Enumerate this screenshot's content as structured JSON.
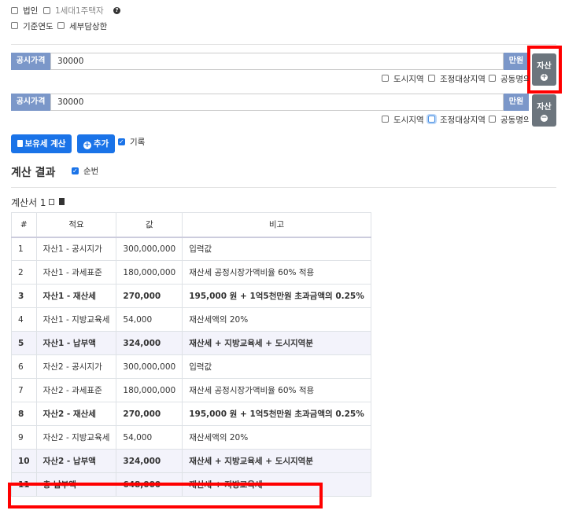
{
  "top_options": {
    "corporation": {
      "label": "법인",
      "checked": false
    },
    "one_house": {
      "label": "1세대1주택자",
      "checked": false
    },
    "base_year": {
      "label": "기준연도",
      "checked": false
    },
    "tax_cap": {
      "label": "세부담상한",
      "checked": false
    }
  },
  "assets": [
    {
      "price_label": "공시가격",
      "price_value": "30000",
      "unit": "만원",
      "button_label": "자산",
      "checks": [
        {
          "label": "도시지역",
          "checked": false
        },
        {
          "label": "조정대상지역",
          "checked": false
        },
        {
          "label": "공동명의",
          "checked": false
        }
      ]
    },
    {
      "price_label": "공시가격",
      "price_value": "30000",
      "unit": "만원",
      "button_label": "자산",
      "checks": [
        {
          "label": "도시지역",
          "checked": false
        },
        {
          "label": "조정대상지역",
          "checked": false
        },
        {
          "label": "공동명의",
          "checked": false
        }
      ]
    }
  ],
  "actions": {
    "calc_label": "보유세 계산",
    "add_label": "추가",
    "record_label": "기록",
    "record_checked": true
  },
  "result": {
    "title": "계산 결과",
    "order_label": "순번",
    "order_checked": true,
    "statement_title": "계산서 1"
  },
  "table": {
    "headers": [
      "#",
      "적요",
      "값",
      "비고"
    ],
    "rows": [
      {
        "no": "1",
        "desc": "자산1 - 공시지가",
        "value": "300,000,000",
        "note": "입력값",
        "bold": false,
        "shade": false
      },
      {
        "no": "2",
        "desc": "자산1 - 과세표준",
        "value": "180,000,000",
        "note": "재산세 공정시장가액비율 60% 적용",
        "bold": false,
        "shade": false
      },
      {
        "no": "3",
        "desc": "자산1 - 재산세",
        "value": "270,000",
        "note": "195,000 원 + 1억5천만원 초과금액의 0.25%",
        "bold": true,
        "shade": false
      },
      {
        "no": "4",
        "desc": "자산1 - 지방교육세",
        "value": "54,000",
        "note": "재산세액의 20%",
        "bold": false,
        "shade": false
      },
      {
        "no": "5",
        "desc": "자산1 - 납부액",
        "value": "324,000",
        "note": "재산세 + 지방교육세 + 도시지역분",
        "bold": true,
        "shade": true
      },
      {
        "no": "6",
        "desc": "자산2 - 공시지가",
        "value": "300,000,000",
        "note": "입력값",
        "bold": false,
        "shade": false
      },
      {
        "no": "7",
        "desc": "자산2 - 과세표준",
        "value": "180,000,000",
        "note": "재산세 공정시장가액비율 60% 적용",
        "bold": false,
        "shade": false
      },
      {
        "no": "8",
        "desc": "자산2 - 재산세",
        "value": "270,000",
        "note": "195,000 원 + 1억5천만원 초과금액의 0.25%",
        "bold": true,
        "shade": false
      },
      {
        "no": "9",
        "desc": "자산2 - 지방교육세",
        "value": "54,000",
        "note": "재산세액의 20%",
        "bold": false,
        "shade": false
      },
      {
        "no": "10",
        "desc": "자산2 - 납부액",
        "value": "324,000",
        "note": "재산세 + 지방교육세 + 도시지역분",
        "bold": true,
        "shade": true
      },
      {
        "no": "11",
        "desc": "총 납부액",
        "value": "648,000",
        "note": "재산세 + 지방교육세",
        "bold": true,
        "shade": true
      }
    ]
  },
  "colors": {
    "accent": "#1a73e8",
    "addon": "#7b97c9",
    "asset_button": "#6c757d",
    "highlight": "#ff0000"
  }
}
